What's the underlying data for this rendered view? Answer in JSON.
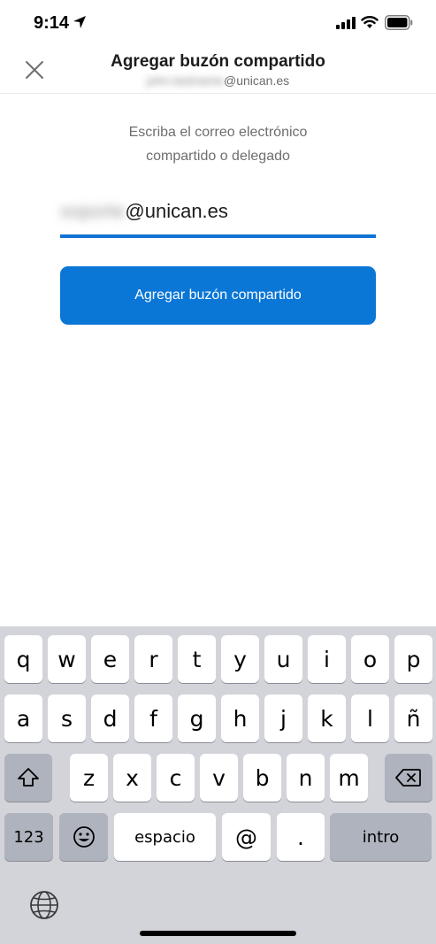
{
  "status_bar": {
    "time": "9:14"
  },
  "header": {
    "title": "Agregar buzón compartido",
    "subtitle_blurred": "john.lastname",
    "subtitle_domain": "@unican.es"
  },
  "form": {
    "instructions_line1": "Escriba el correo electrónico",
    "instructions_line2": "compartido o delegado",
    "email_blurred": "soporte",
    "email_domain": "@unican.es",
    "submit_label": "Agregar buzón compartido"
  },
  "keyboard": {
    "row1": [
      "q",
      "w",
      "e",
      "r",
      "t",
      "y",
      "u",
      "i",
      "o",
      "p"
    ],
    "row2": [
      "a",
      "s",
      "d",
      "f",
      "g",
      "h",
      "j",
      "k",
      "l",
      "ñ"
    ],
    "row3": [
      "z",
      "x",
      "c",
      "v",
      "b",
      "n",
      "m"
    ],
    "numbers_label": "123",
    "space_label": "espacio",
    "at_label": "@",
    "dot_label": ".",
    "return_label": "intro"
  },
  "colors": {
    "accent": "#0a76d6",
    "underline": "#0f74d4",
    "keyboard_bg": "#d2d4da"
  }
}
